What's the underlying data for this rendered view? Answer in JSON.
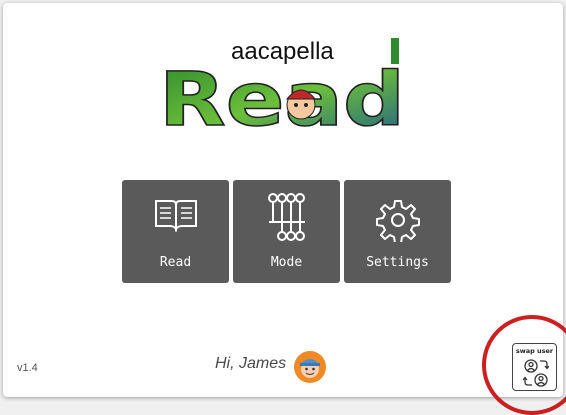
{
  "app": {
    "logo": {
      "top_text": "aacapella",
      "main_text": "Read"
    }
  },
  "menu": {
    "items": [
      {
        "label": "Read",
        "icon": "book-icon"
      },
      {
        "label": "Mode",
        "icon": "mode-icon"
      },
      {
        "label": "Settings",
        "icon": "gear-icon"
      }
    ]
  },
  "footer": {
    "version": "v1.4",
    "greeting": "Hi, James",
    "swap_label": "swap user"
  },
  "colors": {
    "tile_bg": "#5a5a5a",
    "highlight_circle": "#cc2020",
    "logo_green": "#2e8b2e",
    "logo_red": "#c0282b"
  }
}
